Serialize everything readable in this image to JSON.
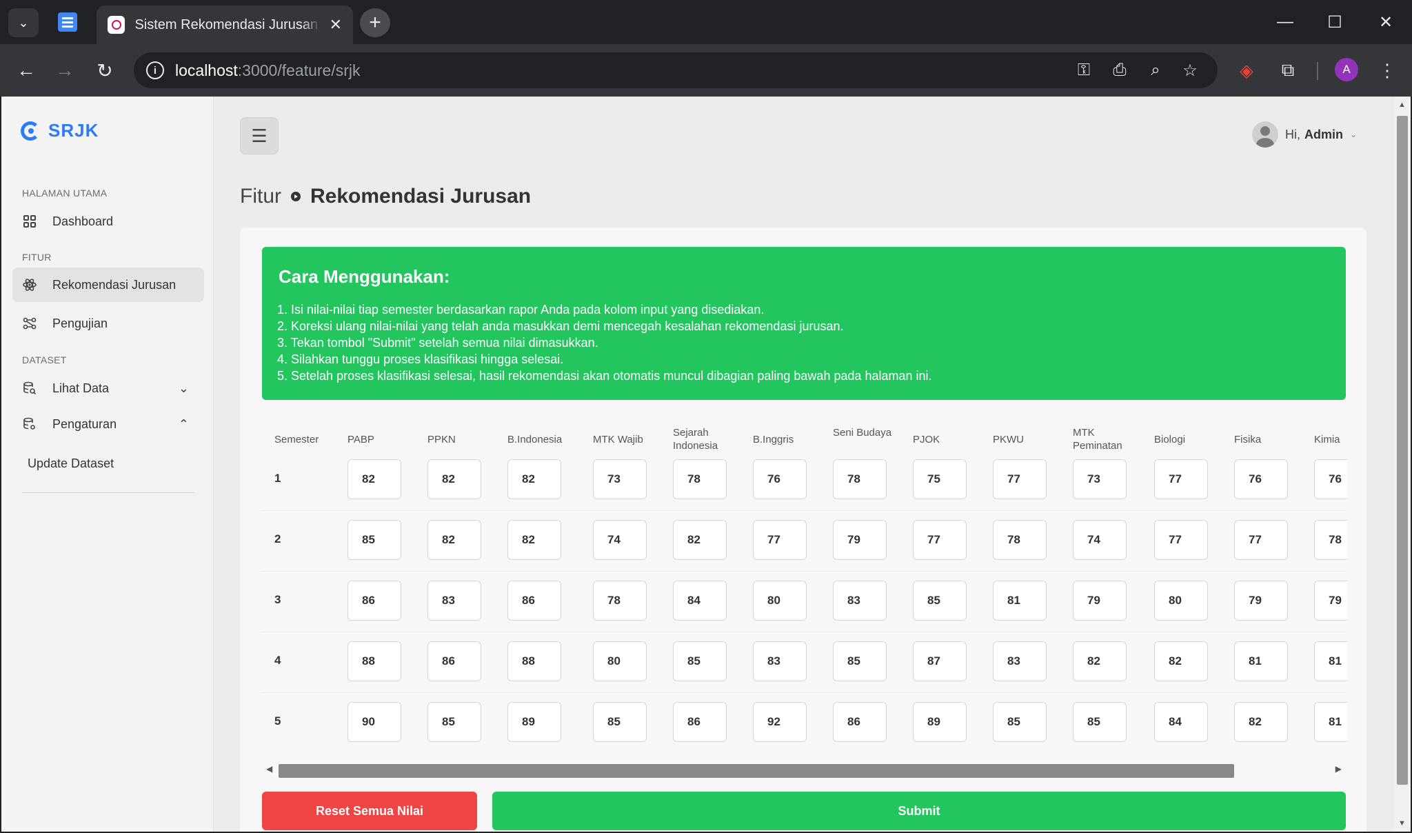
{
  "browser": {
    "tab_title": "Sistem Rekomendasi Jurusan Kuliah",
    "url_host": "localhost",
    "url_path": ":3000/feature/srjk",
    "avatar_letter": "A"
  },
  "sidebar": {
    "brand": "SRJK",
    "sections": [
      {
        "label": "HALAMAN UTAMA",
        "items": [
          {
            "label": "Dashboard",
            "icon": "grid-icon"
          }
        ]
      },
      {
        "label": "FITUR",
        "items": [
          {
            "label": "Rekomendasi Jurusan",
            "icon": "atom-icon",
            "active": true
          },
          {
            "label": "Pengujian",
            "icon": "nodes-icon"
          }
        ]
      },
      {
        "label": "DATASET",
        "items": [
          {
            "label": "Lihat Data",
            "icon": "database-search-icon",
            "expanded": false
          },
          {
            "label": "Pengaturan",
            "icon": "database-settings-icon",
            "expanded": true
          }
        ]
      }
    ],
    "submenu": [
      "Update Dataset"
    ]
  },
  "header": {
    "greeting": "Hi,",
    "user_name": "Admin"
  },
  "breadcrumb": {
    "root": "Fitur",
    "current": "Rekomendasi Jurusan"
  },
  "instructions": {
    "title": "Cara Menggunakan:",
    "steps": [
      "1. Isi nilai-nilai tiap semester berdasarkan rapor Anda pada kolom input yang disediakan.",
      "2. Koreksi ulang nilai-nilai yang telah anda masukkan demi mencegah kesalahan rekomendasi jurusan.",
      "3. Tekan tombol \"Submit\" setelah semua nilai dimasukkan.",
      "4. Silahkan tunggu proses klasifikasi hingga selesai.",
      "5. Setelah proses klasifikasi selesai, hasil rekomendasi akan otomatis muncul dibagian paling bawah pada halaman ini."
    ]
  },
  "grades": {
    "row_header": "Semester",
    "columns": [
      "PABP",
      "PPKN",
      "B.Indonesia",
      "MTK Wajib",
      "Sejarah Indonesia",
      "B.Inggris",
      "Seni Budaya",
      "PJOK",
      "PKWU",
      "MTK Peminatan",
      "Biologi",
      "Fisika",
      "Kimia"
    ],
    "rows": [
      {
        "semester": "1",
        "values": [
          "82",
          "82",
          "82",
          "73",
          "78",
          "76",
          "78",
          "75",
          "77",
          "73",
          "77",
          "76",
          "76"
        ]
      },
      {
        "semester": "2",
        "values": [
          "85",
          "82",
          "82",
          "74",
          "82",
          "77",
          "79",
          "77",
          "78",
          "74",
          "77",
          "77",
          "78"
        ]
      },
      {
        "semester": "3",
        "values": [
          "86",
          "83",
          "86",
          "78",
          "84",
          "80",
          "83",
          "85",
          "81",
          "79",
          "80",
          "79",
          "79"
        ]
      },
      {
        "semester": "4",
        "values": [
          "88",
          "86",
          "88",
          "80",
          "85",
          "83",
          "85",
          "87",
          "83",
          "82",
          "82",
          "81",
          "81"
        ]
      },
      {
        "semester": "5",
        "values": [
          "90",
          "85",
          "89",
          "85",
          "86",
          "92",
          "86",
          "89",
          "85",
          "85",
          "84",
          "82",
          "81"
        ]
      }
    ]
  },
  "buttons": {
    "reset": "Reset Semua Nilai",
    "submit": "Submit"
  },
  "colors": {
    "accent_green": "#22c55e",
    "danger_red": "#ef4444",
    "brand_blue": "#2f7bf5"
  }
}
